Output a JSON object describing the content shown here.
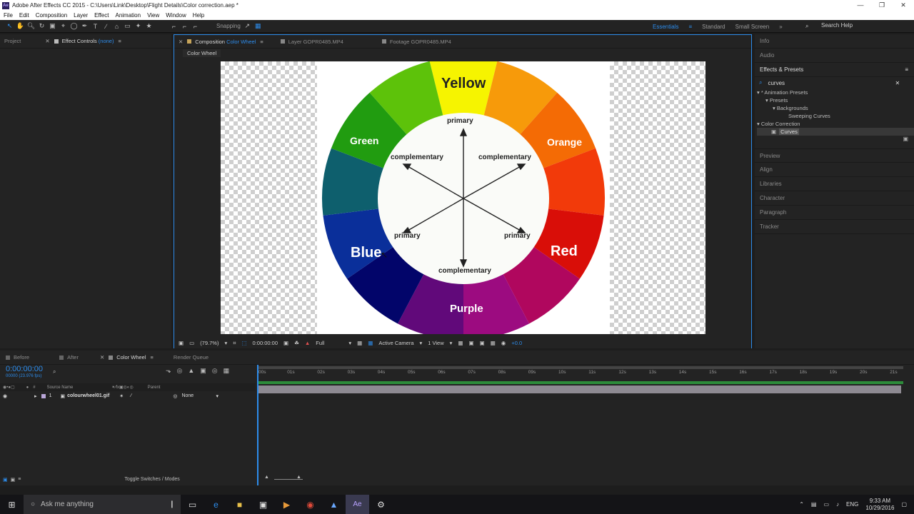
{
  "title": "Adobe After Effects CC 2015 - C:\\Users\\Link\\Desktop\\Flight Details\\Color correction.aep *",
  "window_controls": [
    "—",
    "❐",
    "✕"
  ],
  "menu": [
    "File",
    "Edit",
    "Composition",
    "Layer",
    "Effect",
    "Animation",
    "View",
    "Window",
    "Help"
  ],
  "toolbar": {
    "snapping": "Snapping"
  },
  "workspaces": {
    "active": "Essentials",
    "items": [
      "Standard",
      "Small Screen"
    ],
    "search_help": "Search Help"
  },
  "left_panel": {
    "tabs": [
      "Project",
      "Effect Controls"
    ],
    "effect_controls_target": "(none)"
  },
  "comp_panel": {
    "tabs": [
      {
        "label": "Composition",
        "sub": "Color Wheel"
      },
      {
        "label": "Layer",
        "sub": "GOPR0485.MP4"
      },
      {
        "label": "Footage",
        "sub": "GOPR0485.MP4"
      }
    ],
    "breadcrumb": "Color Wheel",
    "footer": {
      "zoom": "(79.7%)",
      "timecode": "0:00:00:00",
      "resolution": "Full",
      "camera": "Active Camera",
      "view": "1 View",
      "exposure": "+0.0"
    }
  },
  "wheel": {
    "labels": {
      "yellow": "Yellow",
      "orange": "Orange",
      "red": "Red",
      "purple": "Purple",
      "blue": "Blue",
      "green": "Green"
    },
    "diagram": {
      "primary": "primary",
      "complementary": "complementary"
    },
    "colors": [
      "#f6f400",
      "#f79a0a",
      "#f46b05",
      "#f23a0a",
      "#d90e08",
      "#b0075e",
      "#9c0b80",
      "#61097a",
      "#02056a",
      "#0a2f9a",
      "#0e5f6d",
      "#219c10",
      "#5dc20a"
    ]
  },
  "right_panel": {
    "items_top": [
      "Info",
      "Audio"
    ],
    "effects": {
      "title": "Effects & Presets",
      "search": "curves",
      "tree": [
        "▾ * Animation Presets",
        "▾ Presets",
        "▾ Backgrounds",
        "Sweeping Curves",
        "▾ Color Correction",
        "Curves"
      ]
    },
    "items_bottom": [
      "Preview",
      "Align",
      "Libraries",
      "Character",
      "Paragraph",
      "Tracker"
    ]
  },
  "timeline": {
    "tabs": [
      "Before",
      "After",
      "Color Wheel",
      "Render Queue"
    ],
    "timecode": "0:00:00:00",
    "frame_info": "00000 (23.976 fps)",
    "columns": {
      "num": "#",
      "source": "Source Name",
      "parent": "Parent"
    },
    "layer": {
      "index": "1",
      "name": "colourwheel01.gif",
      "parent": "None"
    },
    "ruler": [
      "00s",
      "01s",
      "02s",
      "03s",
      "04s",
      "05s",
      "06s",
      "07s",
      "08s",
      "09s",
      "10s",
      "11s",
      "12s",
      "13s",
      "14s",
      "15s",
      "16s",
      "17s",
      "18s",
      "19s",
      "20s",
      "21s"
    ],
    "footer": "Toggle Switches / Modes"
  },
  "taskbar": {
    "search": "Ask me anything",
    "lang": "ENG",
    "time": "9:33 AM",
    "date": "10/29/2016"
  }
}
